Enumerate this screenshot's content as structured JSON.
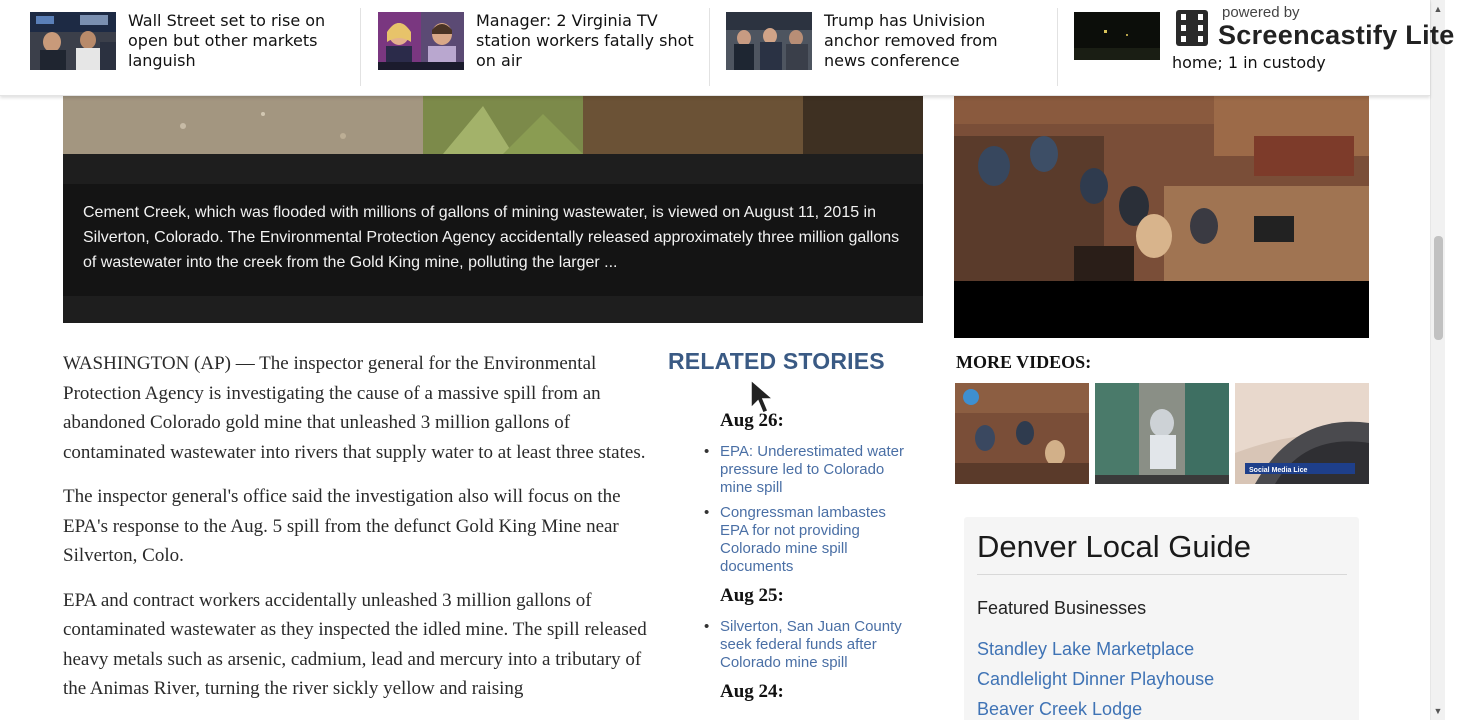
{
  "headlines": [
    {
      "text": "Wall Street set to rise on open but other markets languish",
      "thumb_icon": "trading-floor-photo"
    },
    {
      "text": "Manager: 2 Virginia TV station workers fatally shot on air",
      "thumb_icon": "news-anchors-photo"
    },
    {
      "text": "Trump has Univision anchor removed from news conference",
      "thumb_icon": "press-conference-photo"
    },
    {
      "text": "Police find meth, explosives materials in home; 1 in custody",
      "visible_tail": "home; 1 in custody",
      "thumb_icon": "night-scene-photo"
    }
  ],
  "watermark": {
    "powered_by": "powered by",
    "brand": "Screencastify Lite"
  },
  "photo_caption": "Cement Creek, which was flooded with millions of gallons of mining wastewater, is viewed on August 11, 2015 in Silverton, Colorado. The Environmental Protection Agency accidentally released approximately three million gallons of wastewater into the creek from the Gold King mine, polluting the larger ...",
  "article": {
    "paragraphs": [
      "WASHINGTON (AP) — The inspector general for the Environmental Protection Agency is investigating the cause of a massive spill from an abandoned Colorado gold mine that unleashed 3 million gallons of contaminated wastewater into rivers that supply water to at least three states.",
      "The inspector general's office said the investigation also will focus on the EPA's response to the Aug. 5 spill from the defunct Gold King Mine near Silverton, Colo.",
      "EPA and contract workers accidentally unleashed 3 million gallons of contaminated wastewater as they inspected the idled mine. The spill released heavy metals such as arsenic, cadmium, lead and mercury into a tributary of the Animas River, turning the river sickly yellow and raising"
    ]
  },
  "related": {
    "title": "RELATED STORIES",
    "groups": [
      {
        "date": "Aug 26:",
        "items": [
          "EPA: Underestimated water pressure led to Colorado mine spill",
          "Congressman lambastes EPA for not providing Colorado mine spill documents"
        ]
      },
      {
        "date": "Aug 25:",
        "items": [
          "Silverton, San Juan County seek federal funds after Colorado mine spill"
        ]
      },
      {
        "date": "Aug 24:",
        "items": []
      }
    ]
  },
  "more_videos": {
    "label": "MORE VIDEOS:",
    "thumb3_label": "Social Media Lice"
  },
  "guide": {
    "title": "Denver Local Guide",
    "subtitle": "Featured Businesses",
    "links": [
      "Standley Lake Marketplace",
      "Candlelight Dinner Playhouse",
      "Beaver Creek Lodge"
    ]
  },
  "colors": {
    "related_title": "#3a5a84",
    "link": "#4a6fa5",
    "guide_link": "#3f73b5",
    "caption_bg": "#141414"
  }
}
